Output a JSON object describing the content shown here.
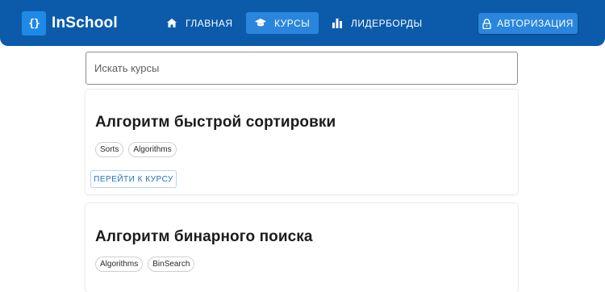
{
  "app": {
    "name": "InSchool",
    "logo_glyph": "{}",
    "brand_color": "#0c5bab",
    "accent_color": "#2a86dc"
  },
  "nav": {
    "items": [
      {
        "label": "ГЛАВНАЯ",
        "icon": "home-icon",
        "active": false
      },
      {
        "label": "КУРСЫ",
        "icon": "graduation-cap-icon",
        "active": true
      },
      {
        "label": "ЛИДЕРБОРДЫ",
        "icon": "bar-chart-icon",
        "active": false
      }
    ],
    "auth": {
      "label": "АВТОРИЗАЦИЯ",
      "icon": "lock-icon"
    }
  },
  "search": {
    "placeholder": "Искать курсы",
    "value": ""
  },
  "courses": [
    {
      "title": "Алгоритм быстрой сортировки",
      "tags": [
        "Sorts",
        "Algorithms"
      ],
      "button_label": "ПЕРЕЙТИ К КУРСУ"
    },
    {
      "title": "Алгоритм бинарного поиска",
      "tags": [
        "Algorithms",
        "BinSearch"
      ]
    }
  ]
}
